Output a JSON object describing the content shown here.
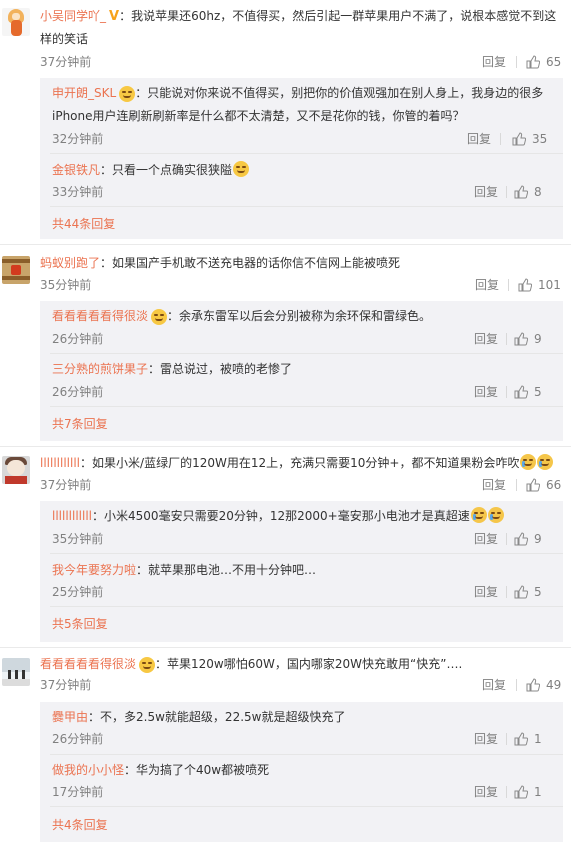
{
  "labels": {
    "reply": "回复",
    "colon": "："
  },
  "threads": [
    {
      "user": "小吴同学吖_",
      "text1": "我说苹果还60hz，不值得买，然后引起一群苹果用户不满了，说根本感觉不到这",
      "text2": "样的笑话",
      "time": "37分钟前",
      "likes": "65",
      "replies": [
        {
          "user": "申开朗_SKL",
          "text1": "只能说对你来说不值得买，别把你的价值观强加在别人身上，我身边的很多",
          "text2": "iPhone用户连刷新刷新率是什么都不太清楚，又不是花你的钱，你管的着吗？",
          "time": "32分钟前",
          "likes": "35"
        },
        {
          "user": "金银铁凡",
          "text1": "只看一个点确实很狭隘",
          "time": "33分钟前",
          "likes": "8"
        }
      ],
      "more": "共44条回复"
    },
    {
      "user": "蚂蚁别跑了",
      "text1": "如果国产手机敢不送充电器的话你信不信网上能被喷死",
      "time": "35分钟前",
      "likes": "101",
      "replies": [
        {
          "user": "看看看看看得很淡",
          "text1": "余承东雷军以后会分别被称为余环保和雷绿色。",
          "time": "26分钟前",
          "likes": "9"
        },
        {
          "user": "三分熟的煎饼果子",
          "text1": "雷总说过，被喷的老惨了",
          "time": "26分钟前",
          "likes": "5"
        }
      ],
      "more": "共7条回复"
    },
    {
      "user": "llllllllllll",
      "text1": "如果小米/蓝绿厂的120W用在12上，充满只需要10分钟+，都不知道果粉会咋吹",
      "time": "37分钟前",
      "likes": "66",
      "replies": [
        {
          "user": "llllllllllll",
          "text1": "小米4500毫安只需要20分钟，12那2000+毫安那小电池才是真超速",
          "time": "35分钟前",
          "likes": "9"
        },
        {
          "user": "我今年要努力啦",
          "text1": "就苹果那电池…不用十分钟吧…",
          "time": "25分钟前",
          "likes": "5"
        }
      ],
      "more": "共5条回复"
    },
    {
      "user": "看看看看看得很淡",
      "text1": "苹果120w哪怕60W，国内哪家20W快充敢用“快充”….",
      "time": "37分钟前",
      "likes": "49",
      "replies": [
        {
          "user": "爨甲由",
          "text1": "不，多2.5w就能超级，22.5w就是超级快充了",
          "time": "26分钟前",
          "likes": "1"
        },
        {
          "user": "做我的小小怪",
          "text1": "华为搞了个40w都被喷死",
          "time": "17分钟前",
          "likes": "1"
        }
      ],
      "more": "共4条回复"
    }
  ]
}
